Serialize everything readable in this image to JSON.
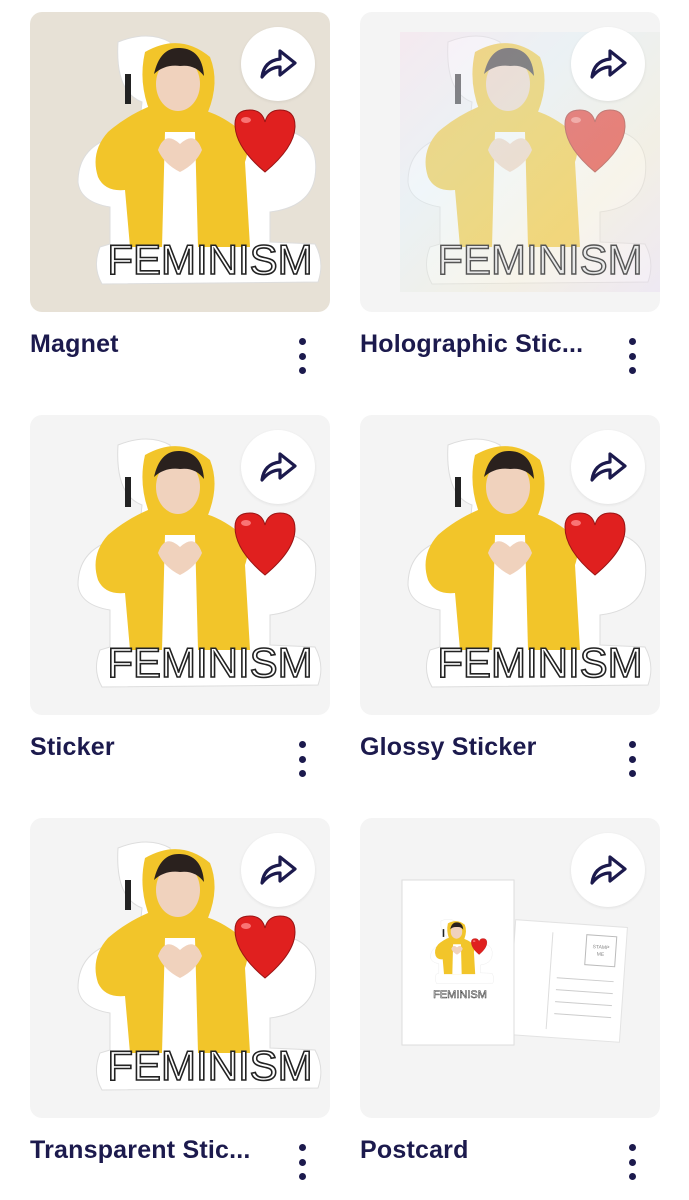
{
  "cards": [
    {
      "title": "Magnet",
      "sticker_text": "FEMINISM",
      "sticker_prefix": "I",
      "style": "magnet"
    },
    {
      "title": "Holographic Stic...",
      "sticker_text": "FEMINISM",
      "sticker_prefix": "I",
      "style": "holographic"
    },
    {
      "title": "Sticker",
      "sticker_text": "FEMINISM",
      "sticker_prefix": "I",
      "style": "sticker"
    },
    {
      "title": "Glossy Sticker",
      "sticker_text": "FEMINISM",
      "sticker_prefix": "I",
      "style": "glossy"
    },
    {
      "title": "Transparent Stic...",
      "sticker_text": "FEMINISM",
      "sticker_prefix": "I",
      "style": "transparent"
    },
    {
      "title": "Postcard",
      "sticker_text": "FEMINISM",
      "sticker_prefix": "I",
      "style": "postcard",
      "stamp_text": "STAMP HERE"
    }
  ],
  "icons": {
    "share": "share-arrow-icon",
    "more": "more-vertical-icon",
    "heart": "heart-icon"
  },
  "colors": {
    "title_text": "#1c1a4d",
    "jacket_yellow": "#f2c52a",
    "heart_red": "#e0201f",
    "card_bg": "#f4f4f4",
    "magnet_bg": "#e7e1d6"
  }
}
